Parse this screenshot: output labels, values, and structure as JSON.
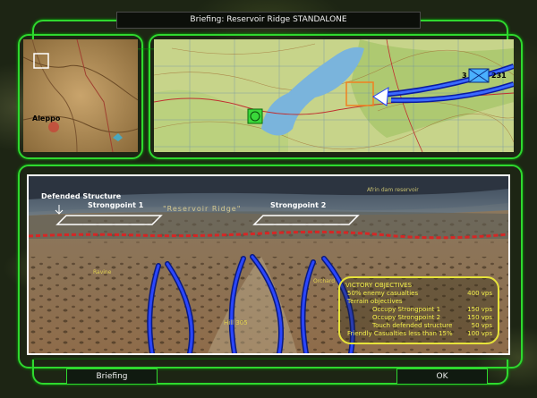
{
  "window": {
    "title": "Briefing:  Reservoir Ridge STANDALONE"
  },
  "minimap": {
    "city_label": "Aleppo"
  },
  "topo_map": {
    "unit_numbers": [
      "3",
      "231"
    ]
  },
  "terrain": {
    "defended_structure": "Defended Structure",
    "strongpoint1": "Strongpoint 1",
    "strongpoint2": "Strongpoint 2",
    "ridge": "\"Reservoir Ridge\"",
    "reservoir": "Afrin dam reservoir",
    "ravine": "Ravine",
    "orchard": "Orchard",
    "hill": "Hill 305"
  },
  "objectives": {
    "title": "VICTORY OBJECTIVES",
    "rows": [
      {
        "label": "50% enemy casualties",
        "value": "400 vps",
        "indent": 1
      },
      {
        "label": "Terrain objectives",
        "value": "",
        "indent": 1
      },
      {
        "label": "Occupy Strongpoint 1",
        "value": "150 vps",
        "indent": 2
      },
      {
        "label": "Occupy Strongpoint 2",
        "value": "150 vps",
        "indent": 2
      },
      {
        "label": "Touch defended structure",
        "value": "50 vps",
        "indent": 2
      },
      {
        "label": "Friendly Casualties less than 15%",
        "value": "100 vps",
        "indent": 1
      }
    ]
  },
  "buttons": {
    "briefing": "Briefing",
    "ok": "OK"
  },
  "colors": {
    "frame": "#2fd82f",
    "objectives": "#e6e23a",
    "arrows": "#1c3cff",
    "fortline": "#e02020"
  }
}
